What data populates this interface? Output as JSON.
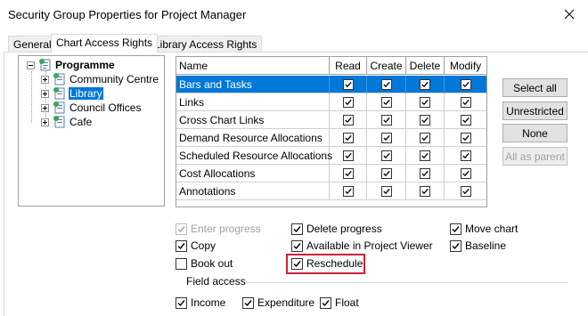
{
  "window": {
    "title": "Security Group Properties for Project Manager",
    "close_icon": "close-icon"
  },
  "tabs": [
    {
      "label": "General",
      "active": false
    },
    {
      "label": "Chart Access Rights",
      "active": true
    },
    {
      "label": "Library Access Rights",
      "active": false
    }
  ],
  "tree": {
    "root": {
      "label": "Programme",
      "expanded": true
    },
    "children": [
      {
        "label": "Community Centre",
        "selected": false
      },
      {
        "label": "Library",
        "selected": true
      },
      {
        "label": "Council Offices",
        "selected": false
      },
      {
        "label": "Cafe",
        "selected": false
      }
    ]
  },
  "grid": {
    "columns": [
      "Name",
      "Read",
      "Create",
      "Delete",
      "Modify"
    ],
    "rows": [
      {
        "name": "Bars and Tasks",
        "selected": true
      },
      {
        "name": "Links",
        "selected": false
      },
      {
        "name": "Cross Chart Links",
        "selected": false
      },
      {
        "name": "Demand Resource Allocations",
        "selected": false
      },
      {
        "name": "Scheduled Resource Allocations",
        "selected": false
      },
      {
        "name": "Cost Allocations",
        "selected": false
      },
      {
        "name": "Annotations",
        "selected": false
      }
    ],
    "all_checked": true
  },
  "buttons": {
    "select_all": "Select all",
    "unrestricted": "Unrestricted",
    "none": "None",
    "all_as_parent": "All as parent"
  },
  "options": {
    "enter_progress": {
      "label": "Enter progress",
      "checked": true,
      "disabled": true
    },
    "delete_progress": {
      "label": "Delete progress",
      "checked": true
    },
    "move_chart": {
      "label": "Move chart",
      "checked": true
    },
    "copy": {
      "label": "Copy",
      "checked": true
    },
    "available_in_project_viewer": {
      "label": "Available in Project Viewer",
      "checked": true
    },
    "baseline": {
      "label": "Baseline",
      "checked": true
    },
    "book_out": {
      "label": "Book out",
      "checked": false
    },
    "reschedule": {
      "label": "Reschedule",
      "checked": true
    }
  },
  "field_access": {
    "label": "Field access",
    "income": {
      "label": "Income",
      "checked": true
    },
    "expenditure": {
      "label": "Expenditure",
      "checked": true
    },
    "float": {
      "label": "Float",
      "checked": true
    }
  },
  "colors": {
    "selection": "#0078d7",
    "highlight": "#d21f3c"
  }
}
